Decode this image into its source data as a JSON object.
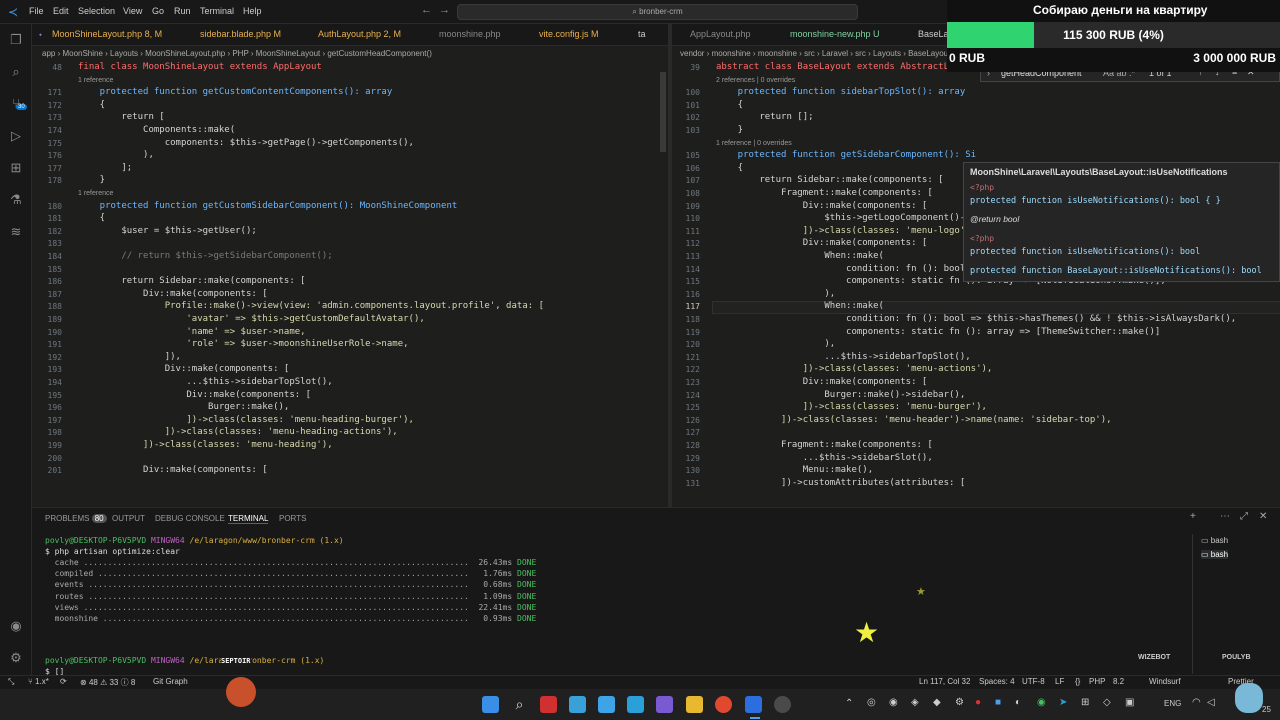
{
  "menu": [
    "File",
    "Edit",
    "Selection",
    "View",
    "Go",
    "Run",
    "Terminal",
    "Help"
  ],
  "search_text": "bronber-crm",
  "left_tabs": [
    {
      "label": "MoonShineLayout.php 8, M",
      "color": "#e8b14e"
    },
    {
      "label": "sidebar.blade.php M",
      "color": "#e8b14e"
    },
    {
      "label": "AuthLayout.php 2, M",
      "color": "#e8b14e"
    },
    {
      "label": "moonshine.php",
      "color": "#888"
    },
    {
      "label": "vite.config.js M",
      "color": "#e8b14e"
    },
    {
      "label": "ta",
      "color": "#ccc"
    }
  ],
  "right_tabs": [
    {
      "label": "AppLayout.php",
      "color": "#888"
    },
    {
      "label": "moonshine-new.php U",
      "color": "#7fd0a0"
    },
    {
      "label": "BaseLay",
      "color": "#ccc"
    }
  ],
  "left_breadcrumb": "app › MoonShine › Layouts › MoonShineLayout.php › PHP › MoonShineLayout › getCustomHeadComponent()",
  "right_breadcrumb": "vendor › moonshine › moonshine › src › Laravel › src › Layouts › BaseLayout.php › PHP intelephense › BaseLayout › getHeadComponent",
  "left_code": [
    {
      "ln": "48",
      "text": "final class MoonShineLayout extends AppLayout",
      "ref": ""
    },
    {
      "ln": "",
      "text": "",
      "ref": "1 reference"
    },
    {
      "ln": "171",
      "text": "    protected function getCustomContentComponents(): array",
      "ref": ""
    },
    {
      "ln": "172",
      "text": "    {",
      "ref": ""
    },
    {
      "ln": "173",
      "text": "        return [",
      "ref": ""
    },
    {
      "ln": "174",
      "text": "            Components::make(",
      "ref": ""
    },
    {
      "ln": "175",
      "text": "                components: $this->getPage()->getComponents(),",
      "ref": ""
    },
    {
      "ln": "176",
      "text": "            ),",
      "ref": ""
    },
    {
      "ln": "177",
      "text": "        ];",
      "ref": ""
    },
    {
      "ln": "178",
      "text": "    }",
      "ref": ""
    },
    {
      "ln": "",
      "text": "",
      "ref": "1 reference"
    },
    {
      "ln": "180",
      "text": "    protected function getCustomSidebarComponent(): MoonShineComponent",
      "ref": ""
    },
    {
      "ln": "181",
      "text": "    {",
      "ref": ""
    },
    {
      "ln": "182",
      "text": "        $user = $this->getUser();",
      "ref": ""
    },
    {
      "ln": "183",
      "text": "",
      "ref": ""
    },
    {
      "ln": "184",
      "text": "        // return $this->getSidebarComponent();",
      "ref": ""
    },
    {
      "ln": "185",
      "text": "",
      "ref": ""
    },
    {
      "ln": "186",
      "text": "        return Sidebar::make(components: [",
      "ref": ""
    },
    {
      "ln": "187",
      "text": "            Div::make(components: [",
      "ref": ""
    },
    {
      "ln": "188",
      "text": "                Profile::make()->view(view: 'admin.components.layout.profile', data: [",
      "ref": ""
    },
    {
      "ln": "189",
      "text": "                    'avatar' => $this->getCustomDefaultAvatar(),",
      "ref": ""
    },
    {
      "ln": "190",
      "text": "                    'name' => $user->name,",
      "ref": ""
    },
    {
      "ln": "191",
      "text": "                    'role' => $user->moonshineUserRole->name,",
      "ref": ""
    },
    {
      "ln": "192",
      "text": "                ]),",
      "ref": ""
    },
    {
      "ln": "193",
      "text": "                Div::make(components: [",
      "ref": ""
    },
    {
      "ln": "194",
      "text": "                    ...$this->sidebarTopSlot(),",
      "ref": ""
    },
    {
      "ln": "195",
      "text": "                    Div::make(components: [",
      "ref": ""
    },
    {
      "ln": "196",
      "text": "                        Burger::make(),",
      "ref": ""
    },
    {
      "ln": "197",
      "text": "                    ])->class(classes: 'menu-heading-burger'),",
      "ref": ""
    },
    {
      "ln": "198",
      "text": "                ])->class(classes: 'menu-heading-actions'),",
      "ref": ""
    },
    {
      "ln": "199",
      "text": "            ])->class(classes: 'menu-heading'),",
      "ref": ""
    },
    {
      "ln": "200",
      "text": "",
      "ref": ""
    },
    {
      "ln": "201",
      "text": "            Div::make(components: [",
      "ref": ""
    }
  ],
  "right_code": [
    {
      "ln": "39",
      "text": "abstract class BaseLayout extends AbstractLayout",
      "ref": ""
    },
    {
      "ln": "",
      "text": "",
      "ref": "2 references | 0 overrides"
    },
    {
      "ln": "100",
      "text": "    protected function sidebarTopSlot(): array",
      "ref": ""
    },
    {
      "ln": "101",
      "text": "    {",
      "ref": ""
    },
    {
      "ln": "102",
      "text": "        return [];",
      "ref": ""
    },
    {
      "ln": "103",
      "text": "    }",
      "ref": ""
    },
    {
      "ln": "",
      "text": "",
      "ref": "1 reference | 0 overrides"
    },
    {
      "ln": "105",
      "text": "    protected function getSidebarComponent(): Si",
      "ref": ""
    },
    {
      "ln": "106",
      "text": "    {",
      "ref": ""
    },
    {
      "ln": "107",
      "text": "        return Sidebar::make(components: [",
      "ref": ""
    },
    {
      "ln": "108",
      "text": "            Fragment::make(components: [",
      "ref": ""
    },
    {
      "ln": "109",
      "text": "                Div::make(components: [",
      "ref": ""
    },
    {
      "ln": "110",
      "text": "                    $this->getLogoComponent()->m",
      "ref": ""
    },
    {
      "ln": "111",
      "text": "                ])->class(classes: 'menu-logo'),",
      "ref": ""
    },
    {
      "ln": "112",
      "text": "                Div::make(components: [",
      "ref": ""
    },
    {
      "ln": "113",
      "text": "                    When::make(",
      "ref": ""
    },
    {
      "ln": "114",
      "text": "                        condition: fn (): bool => $this->isUseNotifications(),",
      "ref": ""
    },
    {
      "ln": "115",
      "text": "                        components: static fn (): array => [Notifications::make()],",
      "ref": ""
    },
    {
      "ln": "116",
      "text": "                    ),",
      "ref": ""
    },
    {
      "ln": "117",
      "text": "                    When::make(",
      "ref": ""
    },
    {
      "ln": "118",
      "text": "                        condition: fn (): bool => $this->hasThemes() && ! $this->isAlwaysDark(),",
      "ref": ""
    },
    {
      "ln": "119",
      "text": "                        components: static fn (): array => [ThemeSwitcher::make()]",
      "ref": ""
    },
    {
      "ln": "120",
      "text": "                    ),",
      "ref": ""
    },
    {
      "ln": "121",
      "text": "                    ...$this->sidebarTopSlot(),",
      "ref": ""
    },
    {
      "ln": "122",
      "text": "                ])->class(classes: 'menu-actions'),",
      "ref": ""
    },
    {
      "ln": "123",
      "text": "                Div::make(components: [",
      "ref": ""
    },
    {
      "ln": "124",
      "text": "                    Burger::make()->sidebar(),",
      "ref": ""
    },
    {
      "ln": "125",
      "text": "                ])->class(classes: 'menu-burger'),",
      "ref": ""
    },
    {
      "ln": "126",
      "text": "            ])->class(classes: 'menu-header')->name(name: 'sidebar-top'),",
      "ref": ""
    },
    {
      "ln": "127",
      "text": "",
      "ref": ""
    },
    {
      "ln": "128",
      "text": "            Fragment::make(components: [",
      "ref": ""
    },
    {
      "ln": "129",
      "text": "                ...$this->sidebarSlot(),",
      "ref": ""
    },
    {
      "ln": "130",
      "text": "                Menu::make(),",
      "ref": ""
    },
    {
      "ln": "131",
      "text": "            ])->customAttributes(attributes: [",
      "ref": ""
    }
  ],
  "find_widget": {
    "query": "getHeadComponent",
    "count": "1 of 1",
    "opts": "Aa  ab  .*"
  },
  "hover": {
    "title": "MoonShine\\Laravel\\Layouts\\BaseLayout::isUseNotifications",
    "lines": [
      "<?php",
      "protected function isUseNotifications(): bool { }",
      "@return  bool",
      "<?php",
      "protected function isUseNotifications(): bool",
      "protected function BaseLayout::isUseNotifications(): bool"
    ]
  },
  "overlay": {
    "title": "Собираю деньги на квартиру",
    "amount": "115 300 RUB (4%)",
    "min": "0 RUB",
    "max": "3 000 000 RUB",
    "progress": 0.04
  },
  "panel_tabs": [
    {
      "label": "PROBLEMS",
      "badge": "80"
    },
    {
      "label": "OUTPUT",
      "badge": ""
    },
    {
      "label": "DEBUG CONSOLE",
      "badge": ""
    },
    {
      "label": "TERMINAL",
      "badge": ""
    },
    {
      "label": "PORTS",
      "badge": ""
    }
  ],
  "terminal": {
    "prompt_user": "povly@DESKTOP-P6V5PVD",
    "prompt_env": "MINGW64",
    "prompt_path": "/e/laragon/www/bronber-crm (1.x)",
    "command": "$ php artisan optimize:clear",
    "rows": [
      {
        "name": "cache",
        "time": "26.43ms",
        "status": "DONE"
      },
      {
        "name": "compiled",
        "time": "1.76ms",
        "status": "DONE"
      },
      {
        "name": "events",
        "time": "0.68ms",
        "status": "DONE"
      },
      {
        "name": "routes",
        "time": "1.09ms",
        "status": "DONE"
      },
      {
        "name": "views",
        "time": "22.41ms",
        "status": "DONE"
      },
      {
        "name": "moonshine",
        "time": "0.93ms",
        "status": "DONE"
      }
    ],
    "prompt2_path": "/e/laragon/bronber-crm (1.x)",
    "prompt2_overlay": "SEPTOIR",
    "last": "$ []",
    "shells": [
      "bash",
      "bash"
    ]
  },
  "statusbar": {
    "branch": "1.x*",
    "errors": "48",
    "warnings": "33",
    "info": "8",
    "git": "Git Graph",
    "position": "Ln 117, Col 32",
    "spaces": "Spaces: 4",
    "encoding": "UTF-8",
    "eol": "LF",
    "lang": "PHP",
    "ver": "8.2",
    "windsurf": "Windsurf",
    "prettier": "Prettier"
  },
  "watermarks": {
    "left": "WIZEBOT",
    "right": "POULYB"
  },
  "tray": {
    "lang": "ENG",
    "time": "25"
  },
  "colors": {
    "accent": "#0078d4",
    "overlay_bar": "#2fd36f",
    "gold": "#e8b14e",
    "keyword": "#ff6b6b"
  }
}
